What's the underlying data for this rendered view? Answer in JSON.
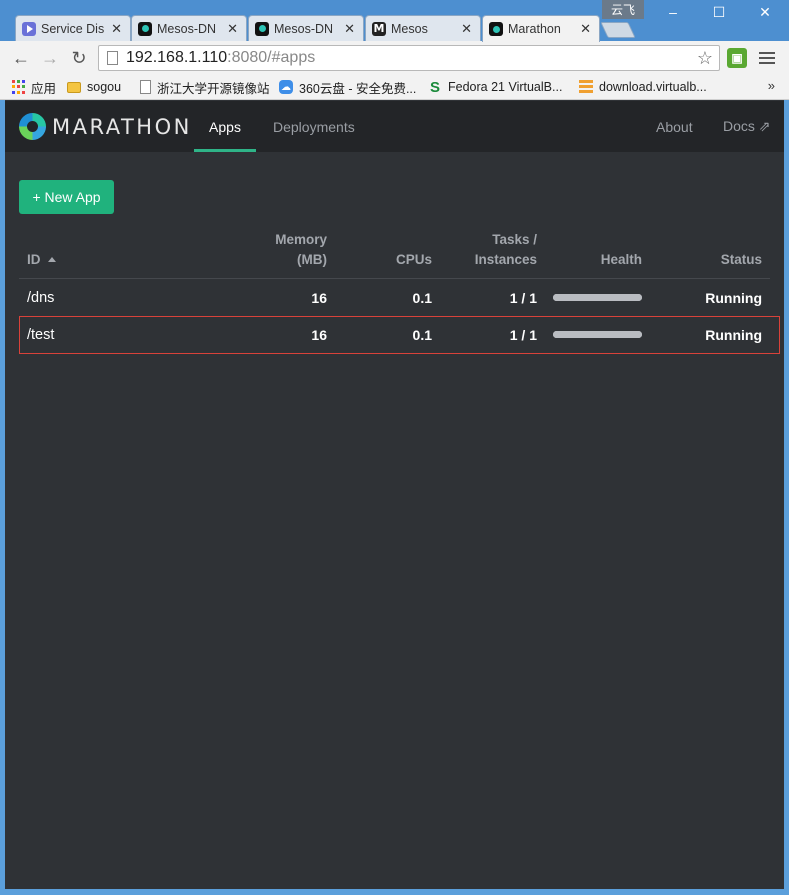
{
  "browser": {
    "tabs": [
      {
        "title": "Service Dis",
        "icon": "service-discovery-icon"
      },
      {
        "title": "Mesos-DN",
        "icon": "mesos-dns-icon"
      },
      {
        "title": "Mesos-DN",
        "icon": "mesos-dns-icon"
      },
      {
        "title": "Mesos",
        "icon": "mesos-icon"
      },
      {
        "title": "Marathon",
        "icon": "marathon-icon",
        "active": true
      }
    ],
    "user": "云飞",
    "window_controls": {
      "minimize": "–",
      "maximize": "☐",
      "close": "✕"
    },
    "url": {
      "host": "192.168.1.110",
      "rest": ":8080/#apps"
    },
    "bookmarks": [
      {
        "label": "应用",
        "icon": "apps-grid-icon"
      },
      {
        "label": "sogou",
        "icon": "folder-icon"
      },
      {
        "label": "浙江大学开源镜像站",
        "icon": "page-icon"
      },
      {
        "label": "360云盘 - 安全免费...",
        "icon": "cloud-icon"
      },
      {
        "label": "Fedora 21 VirtualB...",
        "icon": "s-icon"
      },
      {
        "label": "download.virtualb...",
        "icon": "list-icon"
      }
    ],
    "bookmarks_overflow": "»"
  },
  "marathon": {
    "brand": "MARATHON",
    "nav": {
      "apps": "Apps",
      "deployments": "Deployments",
      "about": "About",
      "docs": "Docs ⇗"
    },
    "new_app_label": "+ New App",
    "columns": {
      "id": "ID",
      "memory_line1": "Memory",
      "memory_line2": "(MB)",
      "cpus": "CPUs",
      "tasks_line1": "Tasks /",
      "tasks_line2": "Instances",
      "health": "Health",
      "status": "Status"
    },
    "apps": [
      {
        "id": "/dns",
        "memory": "16",
        "cpus": "0.1",
        "tasks": "1 / 1",
        "health": 1.0,
        "status": "Running",
        "selected": false
      },
      {
        "id": "/test",
        "memory": "16",
        "cpus": "0.1",
        "tasks": "1 / 1",
        "health": 1.0,
        "status": "Running",
        "selected": true
      }
    ]
  },
  "colors": {
    "accent": "#20b27d",
    "nav_bg": "#232528",
    "page_bg": "#2f3236",
    "selection_border": "#d9423a"
  }
}
